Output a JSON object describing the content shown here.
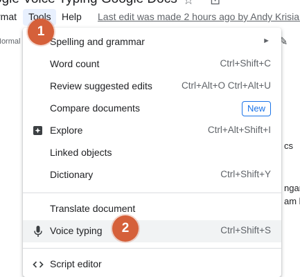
{
  "document": {
    "title": "ogle Voice Typing Google Docs",
    "last_edit": "Last edit was made 2 hours ago by Andy Krisian",
    "style_select": "Normal",
    "behind_texts": [
      "cs",
      "ngan",
      "am b"
    ]
  },
  "menubar": {
    "items": [
      "rmat",
      "Tools",
      "Help"
    ]
  },
  "tools_menu": {
    "items": [
      {
        "label": "Spelling and grammar",
        "shortcut": "",
        "submenu": true
      },
      {
        "label": "Word count",
        "shortcut": "Ctrl+Shift+C"
      },
      {
        "label": "Review suggested edits",
        "shortcut": "Ctrl+Alt+O Ctrl+Alt+U"
      },
      {
        "label": "Compare documents",
        "badge": "New"
      },
      {
        "label": "Explore",
        "shortcut": "Ctrl+Alt+Shift+I",
        "icon": "explore-icon"
      },
      {
        "label": "Linked objects",
        "shortcut": ""
      },
      {
        "label": "Dictionary",
        "shortcut": "Ctrl+Shift+Y"
      },
      {
        "label": "Translate document",
        "shortcut": ""
      },
      {
        "label": "Voice typing",
        "shortcut": "Ctrl+Shift+S",
        "icon": "microphone-icon"
      },
      {
        "label": "Script editor",
        "shortcut": "",
        "icon": "code-icon"
      }
    ]
  },
  "steps": [
    "1",
    "2"
  ],
  "colors": {
    "step_badge": "#d5603a",
    "accent": "#1a73e8",
    "hover": "#f1f3f4"
  }
}
